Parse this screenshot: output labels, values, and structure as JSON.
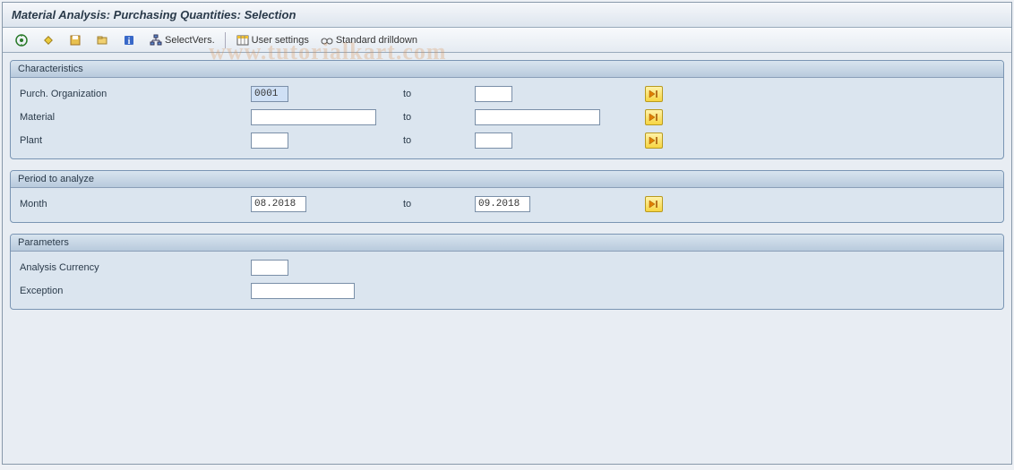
{
  "title": "Material Analysis: Purchasing Quantities: Selection",
  "toolbar": {
    "select_vers": "SelectVers.",
    "user_settings": "User settings",
    "std_drilldown": "Standard drilldown"
  },
  "groups": {
    "characteristics": {
      "title": "Characteristics",
      "rows": {
        "purch_org": {
          "label": "Purch. Organization",
          "from": "0001",
          "to_label": "to",
          "to": ""
        },
        "material": {
          "label": "Material",
          "from": "",
          "to_label": "to",
          "to": ""
        },
        "plant": {
          "label": "Plant",
          "from": "",
          "to_label": "to",
          "to": ""
        }
      }
    },
    "period": {
      "title": "Period to analyze",
      "row": {
        "label": "Month",
        "from": "08.2018",
        "to_label": "to",
        "to": "09.2018"
      }
    },
    "parameters": {
      "title": "Parameters",
      "rows": {
        "currency": {
          "label": "Analysis Currency",
          "value": ""
        },
        "exception": {
          "label": "Exception",
          "value": ""
        }
      }
    }
  },
  "watermark": "www.tutorialkart.com"
}
